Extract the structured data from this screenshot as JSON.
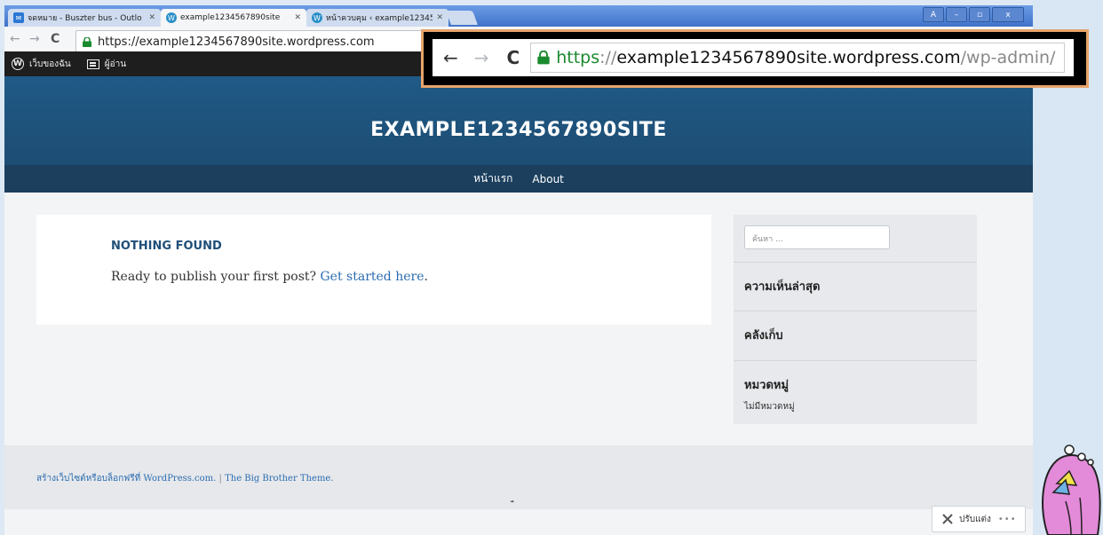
{
  "browser": {
    "tabs": [
      {
        "title": "จดหมาย - Buszter bus - Outlo",
        "icon": "mail-icon",
        "active": false
      },
      {
        "title": "example1234567890site",
        "icon": "wordpress-icon",
        "active": true
      },
      {
        "title": "หน้าควบคุม ‹ example123456",
        "icon": "wordpress-icon",
        "active": false
      }
    ],
    "url": "https://example1234567890site.wordpress.com",
    "window_controls": [
      "A",
      "–",
      "▫",
      "x"
    ]
  },
  "zoom_callout": {
    "https": "https",
    "sep": "://",
    "domain": "example1234567890site.wordpress.com",
    "path": "/wp-admin/"
  },
  "adminbar": {
    "my_site": "เว็บของฉัน",
    "reader": "ผู้อ่าน"
  },
  "site": {
    "title": "EXAMPLE1234567890SITE",
    "nav": [
      "หน้าแรก",
      "About"
    ]
  },
  "content": {
    "heading": "NOTHING FOUND",
    "text": "Ready to publish your first post?",
    "link": "Get started here",
    "period": "."
  },
  "sidebar": {
    "search_placeholder": "ค้นหา ...",
    "recent_comments": "ความเห็นล่าสุด",
    "archives": "คลังเก็บ",
    "categories": "หมวดหมู่",
    "no_categories": "ไม่มีหมวดหมู่"
  },
  "footer": {
    "credit": "สร้างเว็บไซต์หรือบล็อกฟรีที่ WordPress.com.",
    "sep": "|",
    "theme": "The Big Brother Theme.",
    "dot": "ื"
  },
  "customize": {
    "label": "ปรับแต่ง",
    "more": "•••"
  },
  "colors": {
    "header": "#1f5a86",
    "nav": "#1b3f5d",
    "link": "#2b6cb0",
    "callout_border": "#e7a46b"
  }
}
